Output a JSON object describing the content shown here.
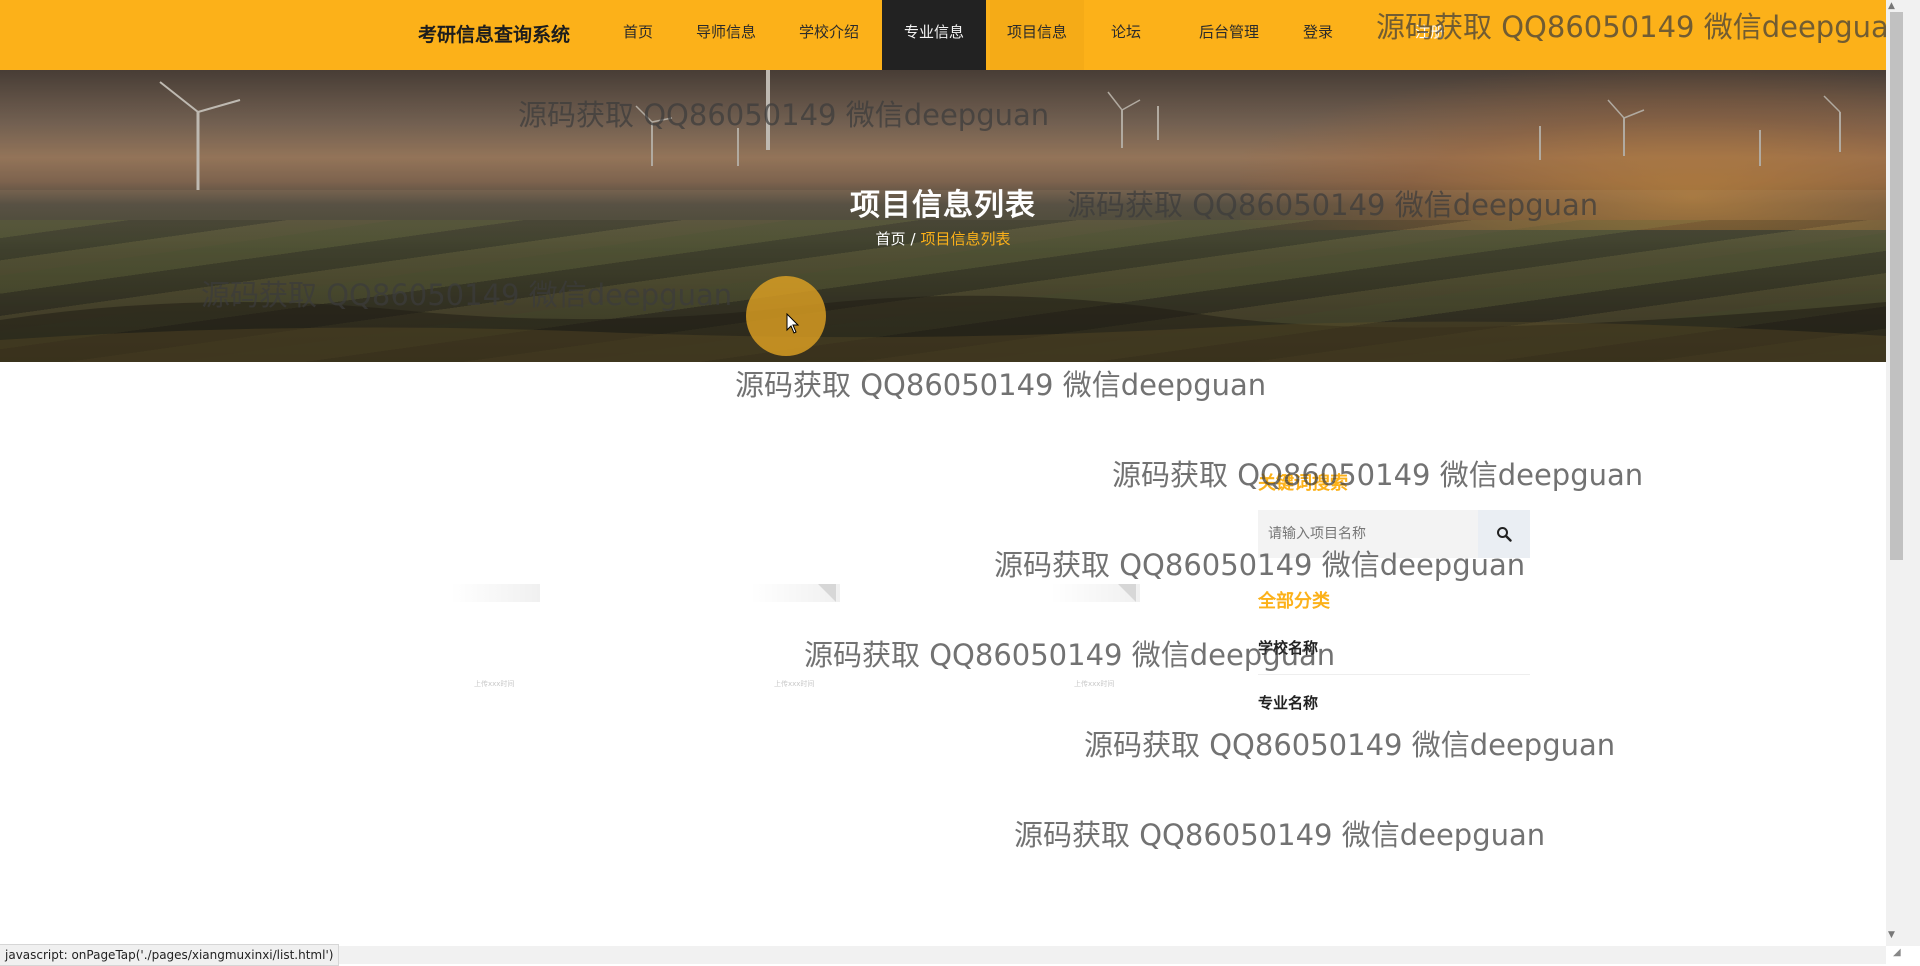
{
  "navbar": {
    "brand": "考研信息查询系统",
    "items": [
      {
        "label": "首页"
      },
      {
        "label": "导师信息"
      },
      {
        "label": "学校介绍"
      },
      {
        "label": "专业信息"
      },
      {
        "label": "项目信息"
      },
      {
        "label": "论坛"
      },
      {
        "label": "后台管理"
      },
      {
        "label": "登录"
      },
      {
        "label": "注册"
      }
    ],
    "active_item": "专业信息",
    "hovered_item": "项目信息"
  },
  "hero": {
    "title": "项目信息列表",
    "breadcrumb_home": "首页",
    "breadcrumb_sep": "/",
    "breadcrumb_current": "项目信息列表"
  },
  "list": {
    "card_captions": [
      "上传xxx时间",
      "上传xxx时间",
      "上传xxx时间"
    ]
  },
  "sidebar": {
    "search_heading": "关键词搜索",
    "search_placeholder": "请输入项目名称",
    "categories_heading": "全部分类",
    "categories": [
      {
        "label": "学校名称"
      },
      {
        "label": "专业名称"
      }
    ]
  },
  "watermark": "源码获取 QQ86050149 微信deepguan",
  "status_bar": {
    "link_text": "javascript: onPageTap('./pages/xiangmuxinxi/list.html')"
  },
  "colors": {
    "accent": "#fcb119",
    "nav_active_bg": "#222222",
    "nav_text": "#2b2b2b"
  },
  "icons": {
    "search": "search-icon",
    "cursor": "mouse-pointer-icon"
  }
}
